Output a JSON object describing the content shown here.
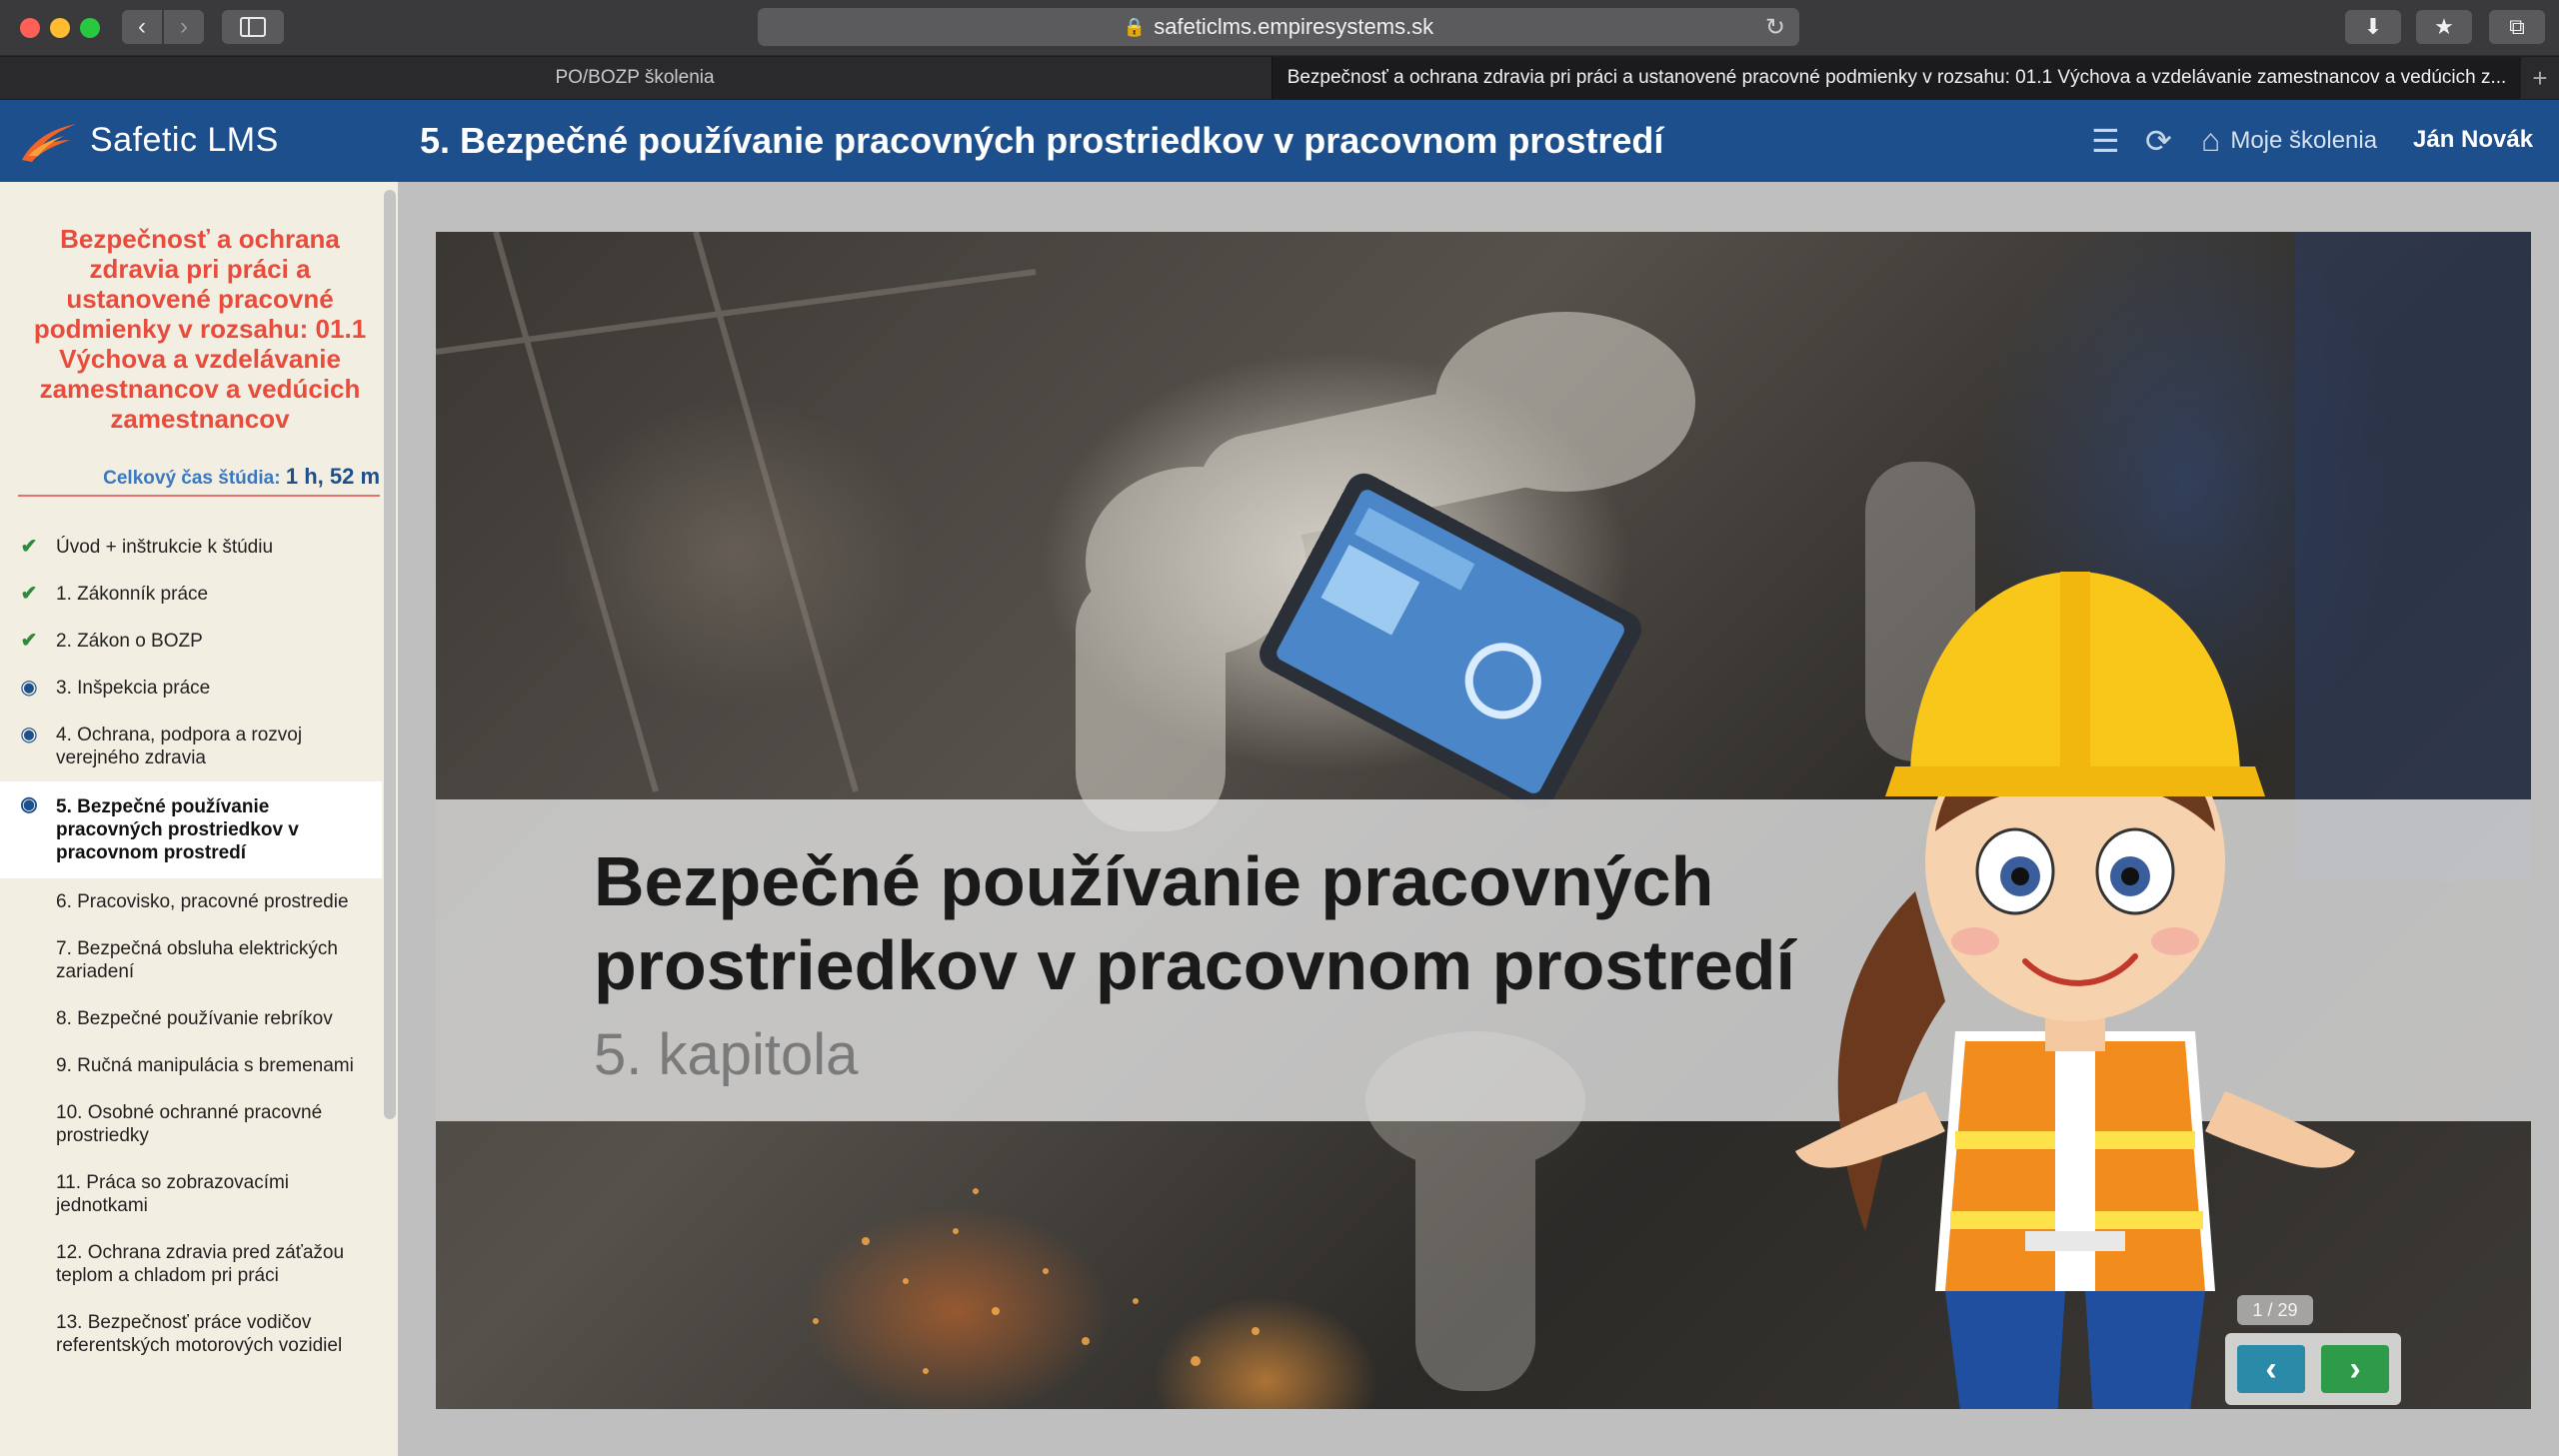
{
  "browser": {
    "url": "safeticlms.empiresystems.sk",
    "tabs": [
      {
        "label": "PO/BOZP školenia"
      },
      {
        "label": "Bezpečnosť a ochrana zdravia pri práci a ustanovené pracovné podmienky v rozsahu: 01.1 Výchova a vzdelávanie zamestnancov a vedúcich z..."
      }
    ]
  },
  "header": {
    "logo_text": "Safetic LMS",
    "chapter_title": "5. Bezpečné používanie pracovných prostriedkov v pracovnom prostredí",
    "home_label": "Moje školenia",
    "user_name": "Ján Novák"
  },
  "sidebar": {
    "course_title": "Bezpečnosť a ochrana zdravia pri práci a ustanovené pracovné podmienky v rozsahu: 01.1 Výchova a vzdelávanie zamestnancov a vedúcich zamestnancov",
    "study_time_label": "Celkový čas štúdia:",
    "study_time_value": "1 h, 52 m",
    "items": [
      {
        "label": "Úvod + inštrukcie k štúdiu",
        "status": "done"
      },
      {
        "label": "1. Zákonník práce",
        "status": "done"
      },
      {
        "label": "2. Zákon o BOZP",
        "status": "done"
      },
      {
        "label": "3. Inšpekcia práce",
        "status": "viewed"
      },
      {
        "label": "4. Ochrana, podpora a rozvoj verejného zdravia",
        "status": "viewed"
      },
      {
        "label": "5. Bezpečné používanie pracovných prostriedkov v pracovnom prostredí",
        "status": "viewed"
      },
      {
        "label": "6. Pracovisko, pracovné prostredie",
        "status": "none"
      },
      {
        "label": "7. Bezpečná obsluha elektrických zariadení",
        "status": "none"
      },
      {
        "label": "8. Bezpečné používanie rebríkov",
        "status": "none"
      },
      {
        "label": "9. Ručná manipulácia s bremenami",
        "status": "none"
      },
      {
        "label": "10. Osobné ochranné pracovné prostriedky",
        "status": "none"
      },
      {
        "label": "11. Práca so zobrazovacími jednotkami",
        "status": "none"
      },
      {
        "label": "12. Ochrana zdravia pred záťažou teplom a chladom pri práci",
        "status": "none"
      },
      {
        "label": "13. Bezpečnosť práce vodičov referentských motorových vozidiel",
        "status": "none"
      }
    ]
  },
  "slide": {
    "heading": "Bezpečné používanie pracovných prostriedkov v pracovnom prostredí",
    "subheading": "5. kapitola",
    "counter": "1 / 29"
  },
  "colors": {
    "header_bg": "#1d4f8c",
    "course_title": "#e84c3d",
    "done_check": "#2e8b3c",
    "prev_button": "#2b8aa8",
    "next_button": "#2e9b48"
  }
}
